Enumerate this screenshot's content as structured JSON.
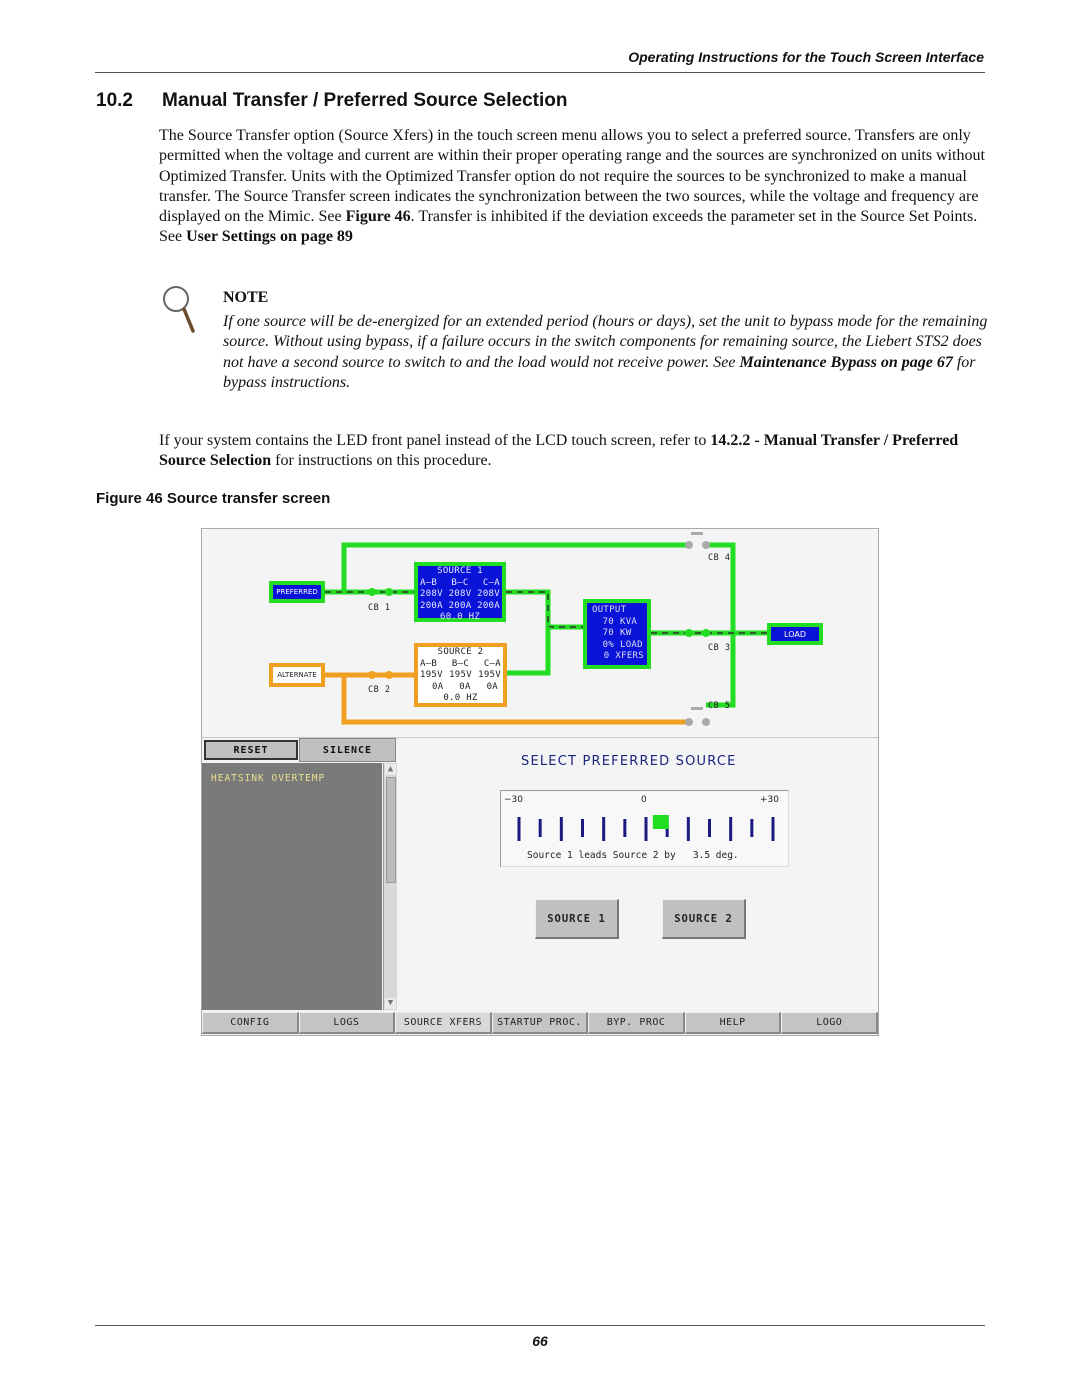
{
  "header": {
    "running_title": "Operating Instructions for the Touch Screen Interface"
  },
  "section": {
    "number": "10.2",
    "title": "Manual Transfer / Preferred Source Selection"
  },
  "body": {
    "p1_a": "The Source Transfer option (Source Xfers) in the touch screen menu allows you to select a preferred source. Transfers are only permitted when the voltage and current are within their proper operating range and the sources are synchronized on units without Optimized Transfer. Units with the Optimized Transfer option do not require the sources to be synchronized to make a manual transfer. The Source Transfer screen indicates the synchronization between the two sources, while the voltage and frequency are displayed on the Mimic. See ",
    "p1_link1": "Figure 46",
    "p1_b": ". Transfer is inhibited if the deviation exceeds the parameter set in the Source Set Points. See ",
    "p1_link2": "User Settings on page 89",
    "p2_a": "If your system contains the LED front panel instead of the LCD touch screen, refer to ",
    "p2_link": "14.2.2 - Manual Transfer / Preferred Source Selection",
    "p2_b": " for instructions on this procedure."
  },
  "note": {
    "label": "NOTE",
    "text_a": "If one source will be de-energized for an extended period (hours or days), set the unit to bypass mode for the remaining source. Without using bypass, if a failure occurs in the switch components for remaining source, the Liebert STS2 does not have a second source to switch to and the load would not receive power. See ",
    "link": "Maintenance Bypass on page 67",
    "text_b": " for bypass instructions."
  },
  "figure": {
    "caption": "Figure 46  Source transfer screen",
    "mimic": {
      "preferred_label": "PREFERRED",
      "alternate_label": "ALTERNATE",
      "load_label": "LOAD",
      "cb": [
        "CB 1",
        "CB 2",
        "CB 3",
        "CB 4",
        "CB 5"
      ],
      "source1": {
        "title": "SOURCE 1",
        "phases": [
          "A–B",
          "B–C",
          "C–A"
        ],
        "volts": [
          "208V",
          "208V",
          "208V"
        ],
        "amps": [
          "200A",
          "200A",
          "200A"
        ],
        "freq": "60.0 HZ"
      },
      "source2": {
        "title": "SOURCE 2",
        "phases": [
          "A–B",
          "B–C",
          "C–A"
        ],
        "volts": [
          "195V",
          "195V",
          "195V"
        ],
        "amps": [
          "0A",
          "0A",
          "0A"
        ],
        "freq": "0.0 HZ"
      },
      "output": {
        "title": "OUTPUT",
        "rows": [
          {
            "value": "70",
            "unit": "KVA"
          },
          {
            "value": "70",
            "unit": "KW"
          },
          {
            "value": "0%",
            "unit": "LOAD"
          },
          {
            "value": "0",
            "unit": "XFERS"
          }
        ]
      },
      "colors": {
        "active_line": "#22dd22",
        "alternate_line": "#f0a020",
        "box_blue": "#0a14d8"
      }
    },
    "alarm_panel": {
      "reset_label": "RESET",
      "silence_label": "SILENCE",
      "alarms": [
        "HEATSINK OVERTEMP"
      ]
    },
    "select": {
      "title": "SELECT PREFERRED SOURCE",
      "scale_min": "−30",
      "scale_zero": "0",
      "scale_max": "+30",
      "phase_deg": 3.5,
      "status_prefix": "Source 1 leads Source 2 by",
      "status_value": "3.5 deg.",
      "source1_button": "SOURCE 1",
      "source2_button": "SOURCE 2"
    },
    "nav": [
      {
        "label": "CONFIG"
      },
      {
        "label": "LOGS"
      },
      {
        "label": "SOURCE XFERS"
      },
      {
        "label": "STARTUP PROC."
      },
      {
        "label": "BYP. PROC"
      },
      {
        "label": "HELP"
      },
      {
        "label": "LOGO"
      }
    ]
  },
  "footer": {
    "page_number": "66"
  }
}
